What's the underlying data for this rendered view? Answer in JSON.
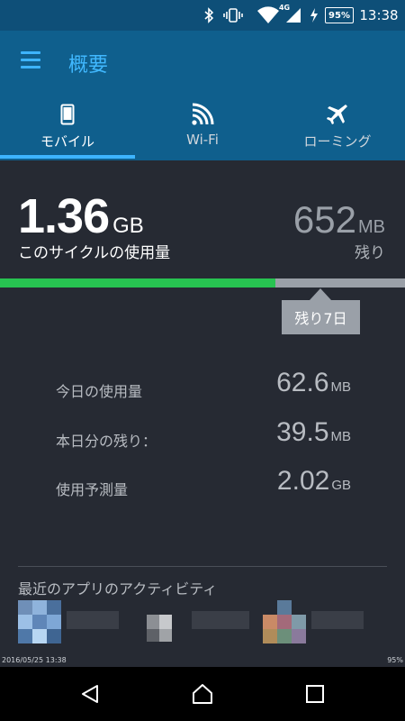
{
  "status_bar": {
    "network_type": "4G",
    "battery_percent": "95%",
    "time": "13:38",
    "icons": [
      "bluetooth-icon",
      "vibrate-icon",
      "wifi-icon",
      "signal-icon",
      "charging-icon",
      "battery-icon"
    ]
  },
  "app_bar": {
    "title": "概要"
  },
  "tabs": [
    {
      "label": "モバイル",
      "icon": "phone-icon",
      "selected": true
    },
    {
      "label": "Wi-Fi",
      "icon": "wifi-icon",
      "selected": false
    },
    {
      "label": "ローミング",
      "icon": "airplane-icon",
      "selected": false
    }
  ],
  "usage": {
    "used_value": "1.36",
    "used_unit": "GB",
    "used_label": "このサイクルの使用量",
    "remaining_value": "652",
    "remaining_unit": "MB",
    "remaining_label": "残り",
    "progress_fraction": 0.68,
    "days_left_label": "残り7日",
    "colors": {
      "used": "#27c351",
      "remaining": "#9aa0a8"
    }
  },
  "stats": [
    {
      "label": "今日の使用量",
      "value": "62.6",
      "unit": "MB"
    },
    {
      "label": "本日分の残り：",
      "value": "39.5",
      "unit": "MB"
    },
    {
      "label": "使用予測量",
      "value": "2.02",
      "unit": "GB"
    }
  ],
  "recent_activity": {
    "title": "最近のアプリのアクティビティ"
  },
  "overlay": {
    "timestamp": "2016/05/25  13:38",
    "battery": "95%"
  },
  "nav_bar": {
    "buttons": [
      "back-icon",
      "home-icon",
      "recents-icon"
    ]
  }
}
